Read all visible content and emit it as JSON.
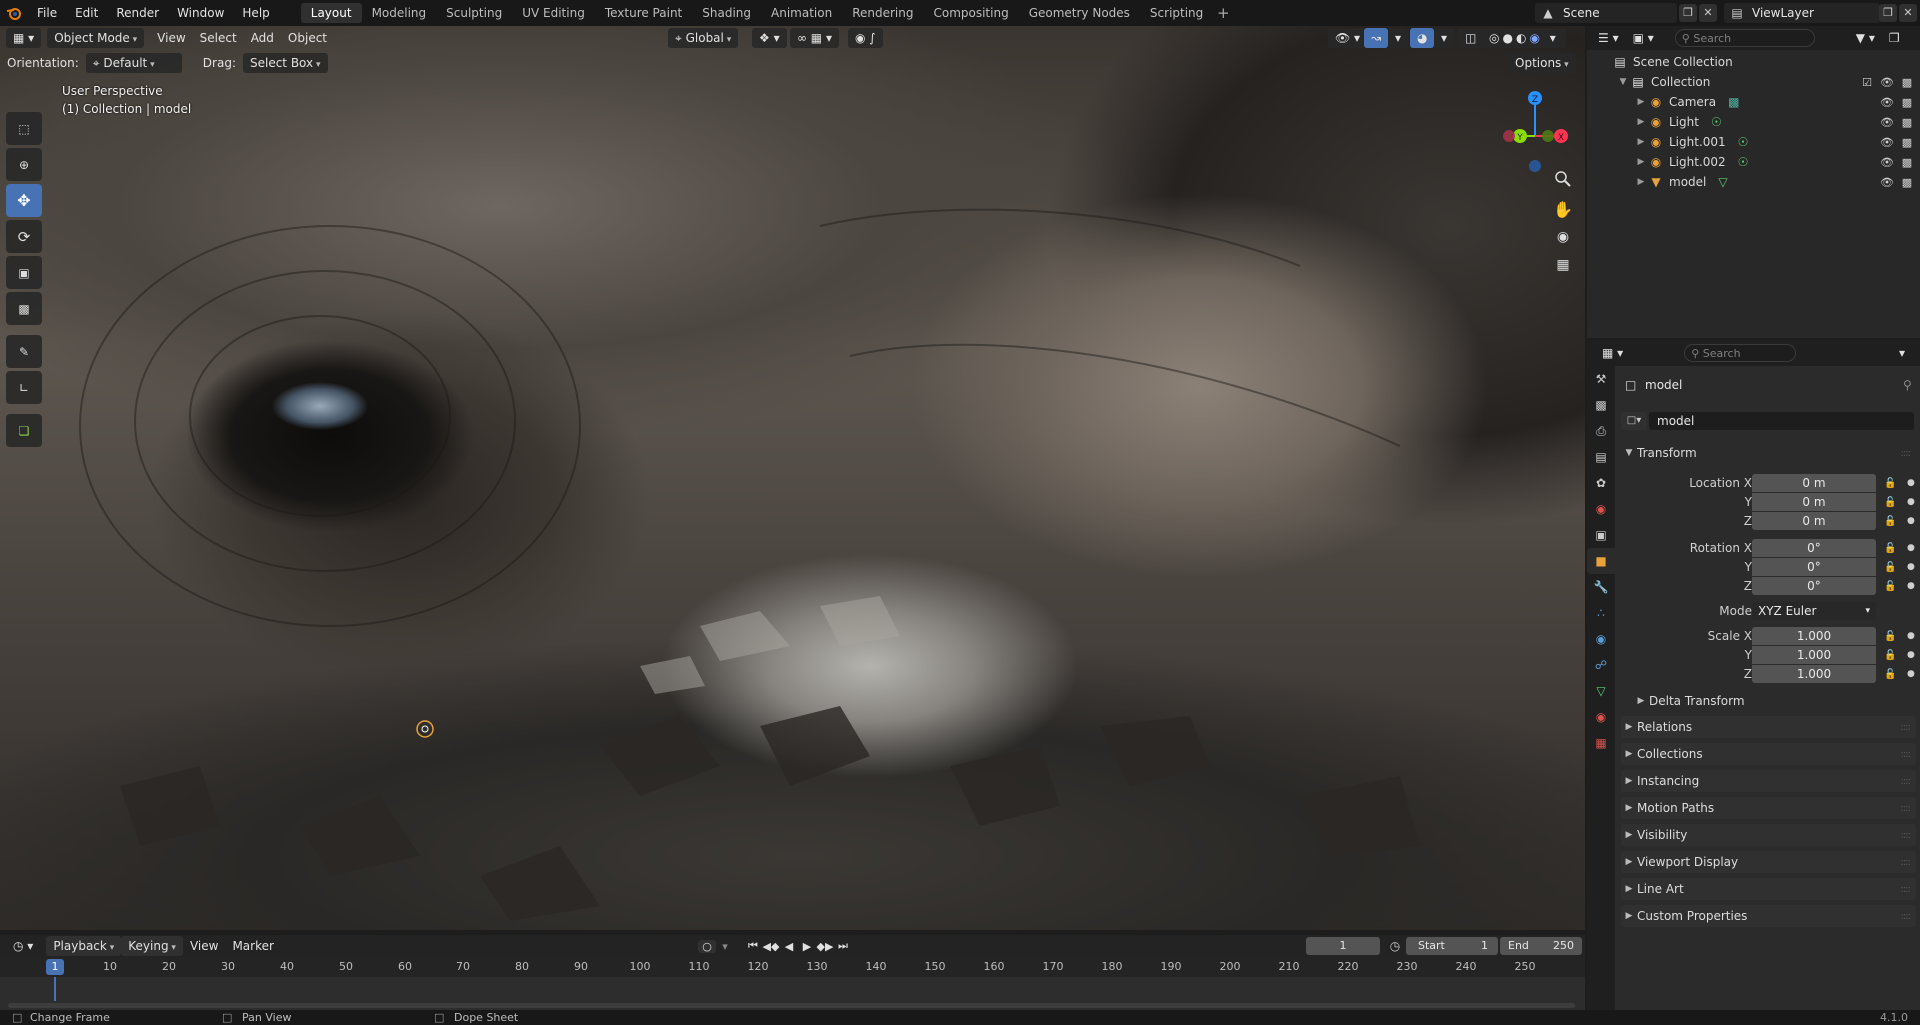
{
  "topbar": {
    "menus": [
      "File",
      "Edit",
      "Render",
      "Window",
      "Help"
    ],
    "workspaces": [
      "Layout",
      "Modeling",
      "Sculpting",
      "UV Editing",
      "Texture Paint",
      "Shading",
      "Animation",
      "Rendering",
      "Compositing",
      "Geometry Nodes",
      "Scripting"
    ],
    "active_workspace": "Layout",
    "add_workspace_label": "+",
    "scene": "Scene",
    "view_layer": "ViewLayer"
  },
  "viewport": {
    "mode": "Object Mode",
    "menu": [
      "View",
      "Select",
      "Add",
      "Object"
    ],
    "transform_orientation": "Global",
    "orientation_label": "Orientation:",
    "orientation_value": "Default",
    "drag_label": "Drag:",
    "drag_value": "Select Box",
    "options_label": "Options",
    "perspective_text": "User Perspective",
    "collection_text": "(1) Collection | model",
    "gizmo": {
      "x": "X",
      "y": "Y",
      "z": "Z"
    },
    "colors": {
      "x_axis": "#ff3352",
      "y_axis": "#8bdc00",
      "z_axis": "#2890ff",
      "active_tool": "#4772b3"
    }
  },
  "outliner": {
    "search_placeholder": "Search",
    "root": "Scene Collection",
    "collection": "Collection",
    "items": [
      {
        "name": "Camera",
        "icon": "camera-icon"
      },
      {
        "name": "Light",
        "icon": "light-icon"
      },
      {
        "name": "Light.001",
        "icon": "light-icon"
      },
      {
        "name": "Light.002",
        "icon": "light-icon"
      },
      {
        "name": "model",
        "icon": "mesh-icon"
      }
    ]
  },
  "properties": {
    "search_placeholder": "Search",
    "object_name": "model",
    "object_field": "model",
    "transform_label": "Transform",
    "location_label": "Location X",
    "rotation_label": "Rotation X",
    "scale_label": "Scale X",
    "y_label": "Y",
    "z_label": "Z",
    "location": [
      "0 m",
      "0 m",
      "0 m"
    ],
    "rotation": [
      "0°",
      "0°",
      "0°"
    ],
    "mode_label": "Mode",
    "mode_value": "XYZ Euler",
    "scale": [
      "1.000",
      "1.000",
      "1.000"
    ],
    "delta_transform": "Delta Transform",
    "panels": [
      "Relations",
      "Collections",
      "Instancing",
      "Motion Paths",
      "Visibility",
      "Viewport Display",
      "Line Art",
      "Custom Properties"
    ]
  },
  "timeline": {
    "menus": [
      "Playback",
      "Keying",
      "View",
      "Marker"
    ],
    "current_frame": "1",
    "start_label": "Start",
    "start": "1",
    "end_label": "End",
    "end": "250",
    "ticks": [
      "10",
      "20",
      "30",
      "40",
      "50",
      "60",
      "70",
      "80",
      "90",
      "100",
      "110",
      "120",
      "130",
      "140",
      "150",
      "160",
      "170",
      "180",
      "190",
      "200",
      "210",
      "220",
      "230",
      "240",
      "250"
    ],
    "cursor_frame": "1"
  },
  "statusbar": {
    "hint1": "Change Frame",
    "hint2": "Pan View",
    "hint3": "Dope Sheet",
    "version": "4.1.0"
  }
}
